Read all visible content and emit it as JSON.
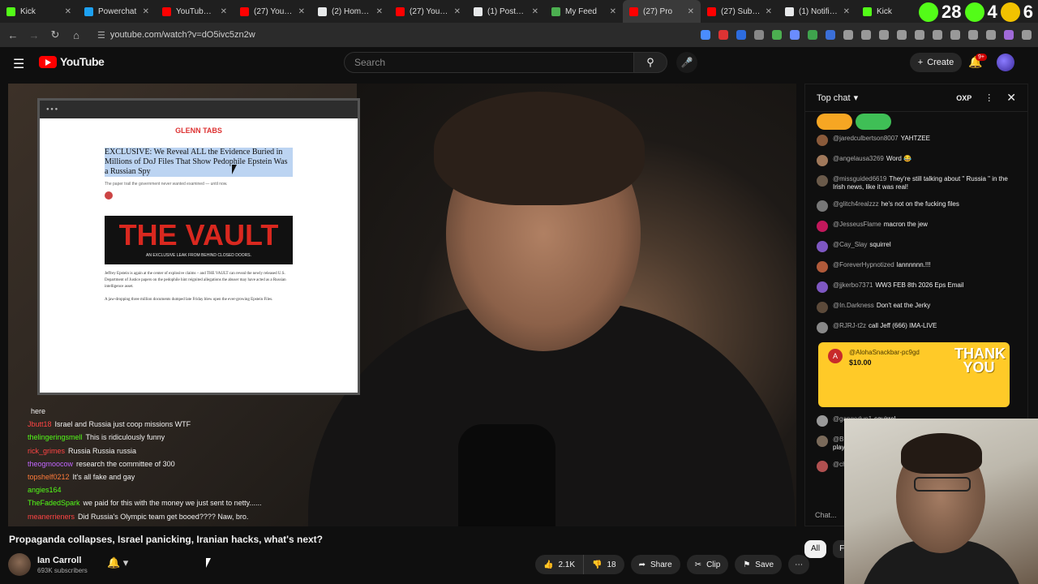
{
  "browser": {
    "tabs": [
      {
        "title": "Kick",
        "color": "#53fc18",
        "active": false
      },
      {
        "title": "Powerchat",
        "color": "#1da1f2",
        "active": false
      },
      {
        "title": "YouTube Mu",
        "color": "#ff0000",
        "active": false
      },
      {
        "title": "(27) YouTube",
        "color": "#ff0000",
        "active": false
      },
      {
        "title": "(2) Home / X",
        "color": "#e7e9ea",
        "active": false
      },
      {
        "title": "(27) YouTube",
        "color": "#ff0000",
        "active": false
      },
      {
        "title": "(1) Posts / X",
        "color": "#e7e9ea",
        "active": false
      },
      {
        "title": "My Feed",
        "color": "#4caf50",
        "active": false
      },
      {
        "title": "(27) Pro",
        "color": "#ff0000",
        "active": true
      },
      {
        "title": "(27) Subscrip",
        "color": "#ff0000",
        "active": false
      },
      {
        "title": "(1) Notificat",
        "color": "#e7e9ea",
        "active": false
      },
      {
        "title": "Kick",
        "color": "#53fc18",
        "active": false
      }
    ],
    "overlay_counts": [
      "28",
      "4",
      "6"
    ],
    "url": "youtube.com/watch?v=dO5ivc5zn2w"
  },
  "youtube": {
    "logo": "YouTube",
    "search_placeholder": "Search",
    "create_label": "Create",
    "notif_badge": "9+"
  },
  "video": {
    "article": {
      "brand": "GLENN TABS",
      "headline": "EXCLUSIVE: We Reveal ALL the Evidence Buried in Millions of DoJ Files That Show Pedophile Epstein Was a Russian Spy",
      "subtitle": "The paper trail the government never wanted examined — until now.",
      "vault": "THE VAULT",
      "vault_sub": "AN EXCLUSIVE LEAK FROM BEHIND CLOSED DOORS.",
      "body1": "Jeffrey Epstein is again at the center of explosive claims – and THE VAULT can reveal the newly released U.S. Department of Justice papers on the pedophile hint reignited allegations the abuser may have acted as a Russian intelligence asset.",
      "body2": "A jaw-dropping three million documents dumped late Friday blew open the ever-growing Epstein Files."
    },
    "chat_overlay": [
      {
        "user": "",
        "text": "here",
        "color": "#ffffff"
      },
      {
        "user": "Jbutt18",
        "text": "Israel and Russia just coop missions WTF",
        "color": "#ff4444"
      },
      {
        "user": "thelingeringsmell",
        "text": "This is ridiculously funny",
        "color": "#53fc18"
      },
      {
        "user": "rick_grimes",
        "text": "Russia Russia russia",
        "color": "#ff4444"
      },
      {
        "user": "theogmoocow",
        "text": "research the committee of 300",
        "color": "#c266ff"
      },
      {
        "user": "topshelf0212",
        "text": "It's all fake and gay",
        "color": "#ff7b3a"
      },
      {
        "user": "angies164",
        "text": "",
        "color": "#53fc18"
      },
      {
        "user": "TheFadedSpark",
        "text": "we paid for this with the money we just sent to netty......",
        "color": "#53fc18"
      },
      {
        "user": "meanerrieners",
        "text": "Did Russia's Olympic team get booed???? Naw, bro.",
        "color": "#ff4444"
      }
    ]
  },
  "chat": {
    "header": "Top chat",
    "oxp": "OXP",
    "messages": [
      {
        "user": "@jaredculbertson8007",
        "text": "YAHTZEE",
        "color": "#8a5a3a"
      },
      {
        "user": "@angelausa3269",
        "text": "Word 😂",
        "color": "#a0785a"
      },
      {
        "user": "@missguided6619",
        "text": "They're still talking about \" Russia \" in the Irish news, like it was real!",
        "color": "#6a5a4a"
      },
      {
        "user": "@glitch4realzzz",
        "text": "he's not on the fucking files",
        "color": "#777777"
      },
      {
        "user": "@JesseusFlame",
        "text": "macron the jew",
        "color": "#c2185b"
      },
      {
        "user": "@Cay_Slay",
        "text": "squirrel",
        "color": "#7e57c2"
      },
      {
        "user": "@ForeverHypnotized",
        "text": "lannnnnn.!!!",
        "color": "#b05a3a"
      },
      {
        "user": "@jjkerbo7371",
        "text": "WW3 FEB 8th 2026 Eps Email",
        "color": "#7e57c2"
      },
      {
        "user": "@In.Darkness",
        "text": "Don't eat the Jerky",
        "color": "#5c4a3a"
      },
      {
        "user": "@RJRJ-t2z",
        "text": "call Jeff (666) IMA-LIVE",
        "color": "#888888"
      }
    ],
    "superchat": {
      "avatar": "A",
      "user": "@AlohaSnackbar-pc9gd",
      "amount": "$10.00",
      "sticker": "THANK YOU"
    },
    "messages_after": [
      {
        "user": "@gangedup1",
        "text": "squirrel",
        "color": "#999999"
      },
      {
        "user": "@BillStreets",
        "text": "as long as ep didn't have the nuke codes, cia played along lol",
        "color": "#7a6a5a"
      },
      {
        "user": "@ch4d_w1ck",
        "text": "is Tim Apple in the fessies?",
        "color": "#b05050"
      }
    ],
    "input_placeholder": "Chat..."
  },
  "below": {
    "title": "Propaganda collapses, Israel panicking, Iranian hacks, what's next?",
    "channel": "Ian Carroll",
    "subscribers": "693K subscribers",
    "likes": "2.1K",
    "dislikes": "18",
    "share": "Share",
    "clip": "Clip",
    "save": "Save",
    "chips": [
      "All",
      "Fr"
    ]
  }
}
